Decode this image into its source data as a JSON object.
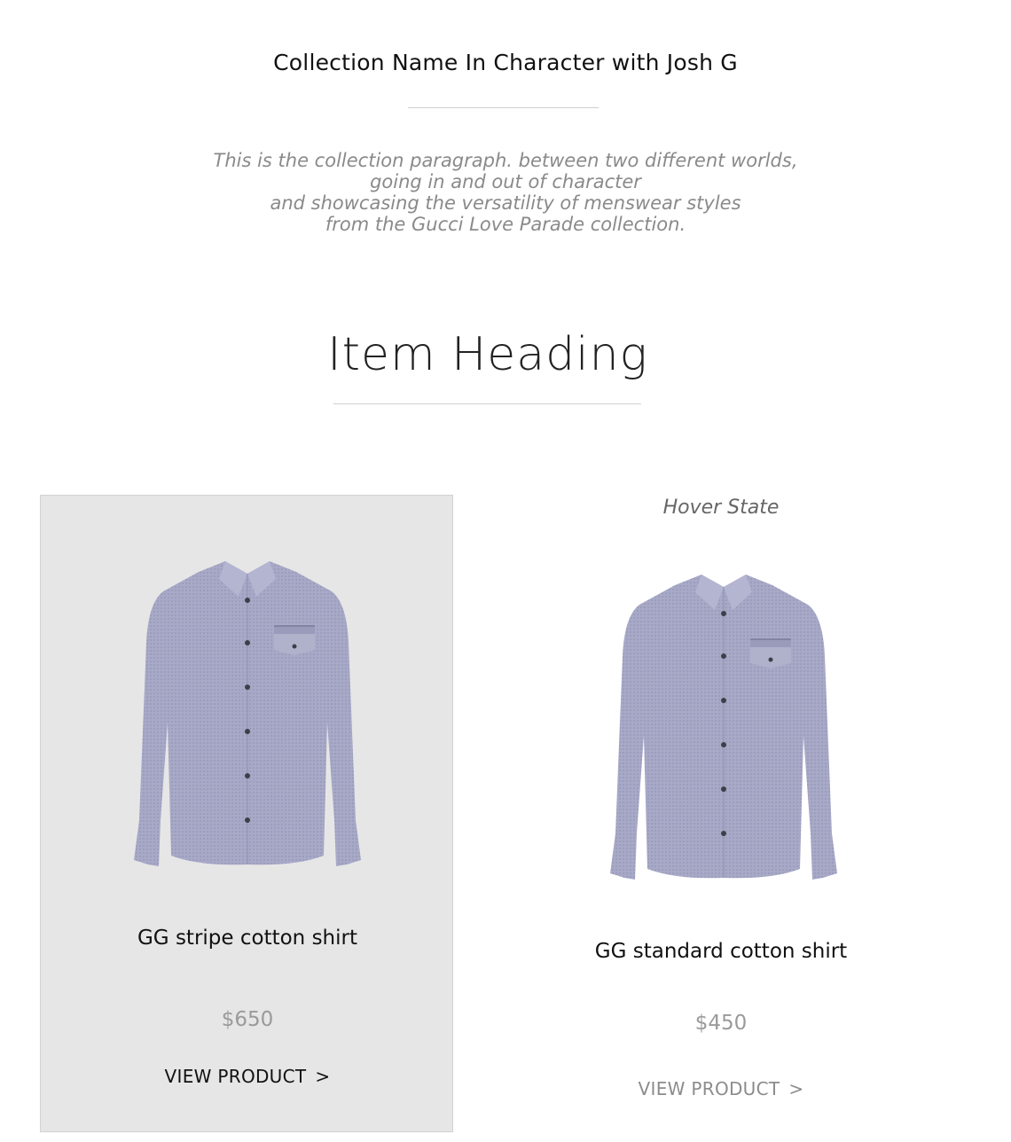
{
  "collection": {
    "title": "Collection Name In Character with Josh G",
    "paragraph_lines": [
      "This is the collection paragraph. between two different worlds,",
      "going in and out of character",
      "and showcasing the versatility of menswear styles",
      "from the Gucci Love Parade collection."
    ]
  },
  "item_heading": "Item Heading",
  "products": [
    {
      "name": "GG stripe cotton shirt",
      "price": "$650",
      "cta_label": "VIEW PRODUCT",
      "cta_icon": "chevron-right-icon",
      "cta_glyph": ">",
      "image": "shirt-image",
      "state": ""
    },
    {
      "name": "GG standard cotton shirt",
      "price": "$450",
      "cta_label": "VIEW PRODUCT",
      "cta_icon": "chevron-right-icon",
      "cta_glyph": ">",
      "image": "shirt-image",
      "state": "Hover State"
    }
  ],
  "colors": {
    "card_background": "#e6e6e6",
    "shirt_fabric": "#a8a9c7",
    "price_text": "#9a9a9a"
  }
}
